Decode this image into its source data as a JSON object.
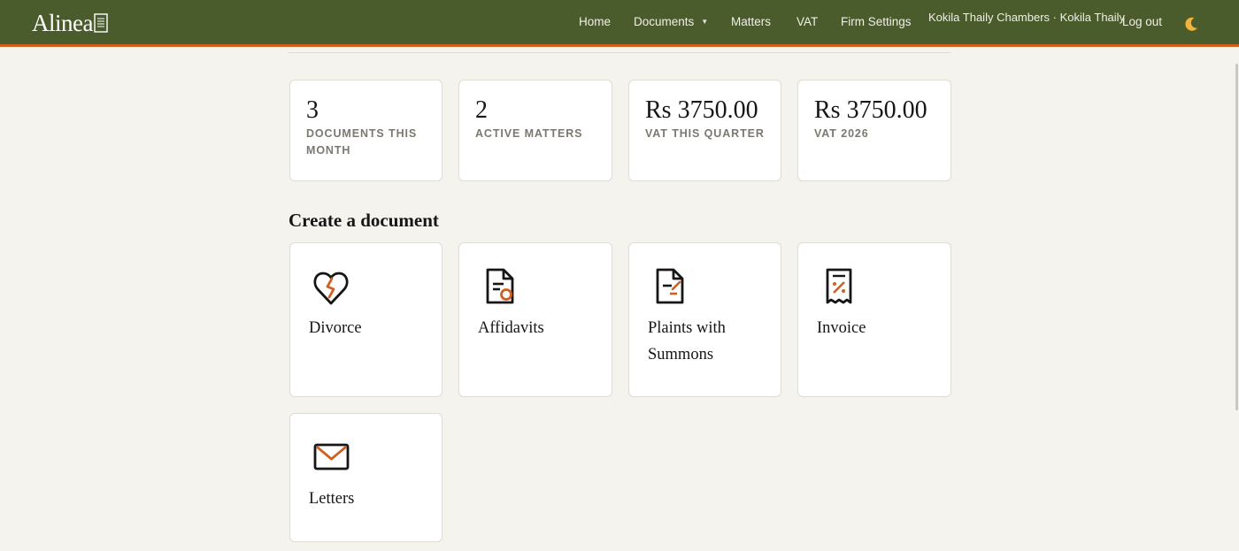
{
  "brand": {
    "name": "Alinea"
  },
  "nav": {
    "home": "Home",
    "documents": "Documents",
    "matters": "Matters",
    "vat": "VAT",
    "firm_settings": "Firm Settings",
    "user": "Kokila Thaily Chambers · Kokila Thaily",
    "logout": "Log out"
  },
  "stats": [
    {
      "value": "3",
      "label": "Documents this month"
    },
    {
      "value": "2",
      "label": "Active matters"
    },
    {
      "value": "Rs 3750.00",
      "label": "VAT this quarter"
    },
    {
      "value": "Rs 3750.00",
      "label": "VAT 2026"
    }
  ],
  "create": {
    "title": "Create a document",
    "items": [
      {
        "label": "Divorce",
        "icon": "broken-heart-icon"
      },
      {
        "label": "Affidavits",
        "icon": "document-seal-icon"
      },
      {
        "label": "Plaints with Summons",
        "icon": "document-edit-icon"
      },
      {
        "label": "Invoice",
        "icon": "receipt-icon"
      },
      {
        "label": "Letters",
        "icon": "envelope-icon"
      }
    ]
  },
  "colors": {
    "nav_bg": "#4a5c2c",
    "accent": "#d35f1f",
    "page_bg": "#f4f3ee"
  }
}
